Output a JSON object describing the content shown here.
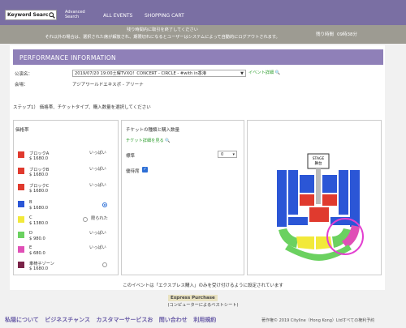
{
  "header": {
    "search_value": "Keyword Searc",
    "advanced_line1": "Advanced",
    "advanced_line2": "Search",
    "nav": [
      "ALL EVENTS",
      "SHOPPING CART"
    ]
  },
  "notice": {
    "line1": "残り時間内に取引を終了してください",
    "line2": "それ以外の場合は、選択された席が解放され、期限切れになるとユーザーはシステムによって自動的にログアウトされます。",
    "timer_label": "残り時間",
    "timer_value": "09時38分"
  },
  "performance": {
    "title": "PERFORMANCE INFORMATION",
    "performance_label": "公演名：",
    "performance_value": "2019/07/20 19:00土曜TVXQ！CONCERT - CIRCLE - #with in香港",
    "event_detail_link": "イベント詳細",
    "venue_label": "会場：",
    "venue_value": "アジアワールドエキスポ - アリーナ"
  },
  "step1": "ステップ1） 価格帯、チケットタイプ、購入数量を選択してください",
  "price_column_title": "価格帯",
  "prices": [
    {
      "name": "ブロックA",
      "price": "$ 1680.0",
      "status": "いっぱい",
      "color": "#e03a2e"
    },
    {
      "name": "ブロックB",
      "price": "$ 1680.0",
      "status": "いっぱい",
      "color": "#e03a2e"
    },
    {
      "name": "ブロックC",
      "price": "$ 1680.0",
      "status": "いっぱい",
      "color": "#e03a2e"
    },
    {
      "name": "B",
      "price": "$ 1680.0",
      "status": "",
      "color": "#2b56d6"
    },
    {
      "name": "C",
      "price": "$ 1380.0",
      "status": "限られた",
      "color": "#f2e93a"
    },
    {
      "name": "D",
      "price": "$ 980.0",
      "status": "いっぱい",
      "color": "#6bd160"
    },
    {
      "name": "E",
      "price": "$ 680.0",
      "status": "いっぱい",
      "color": "#e04fb6"
    },
    {
      "name": "車椅子ゾーン",
      "price": "$ 1680.0",
      "status": "",
      "color": "#7a2348"
    }
  ],
  "ticket_column": {
    "title": "チケットの種類と購入数量",
    "detail_link": "チケット詳細を見る",
    "ticket_type": "標準",
    "quantity": "0",
    "fan_club_label": "優待席"
  },
  "seatmap": {
    "stage_line1": "STAGE",
    "stage_line2": "舞台"
  },
  "express_note": "このイベントは「エクスプレス購入」のみを受け付けるように設定されています",
  "express_button": "Express Purchase",
  "express_sub": "(コンピューターによるベストシート)",
  "footer": {
    "links": [
      "私隠について",
      "ビジネスチャンス",
      "カスタマーサービスお",
      "問い合わせ",
      "利用規約"
    ],
    "copyright": "著作権© 2019 Cityline（Hong Kong）Ltdすべての権利予約"
  },
  "colors": {
    "header_purple": "#7a6fa3",
    "section_purple": "#8f80b8",
    "notice_gray": "#9d9b92",
    "link_green": "#2d9d2d"
  }
}
